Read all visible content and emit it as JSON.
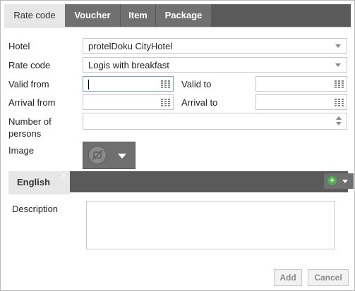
{
  "tabs": [
    {
      "label": "Rate code",
      "active": true
    },
    {
      "label": "Voucher",
      "active": false
    },
    {
      "label": "Item",
      "active": false
    },
    {
      "label": "Package",
      "active": false
    }
  ],
  "form": {
    "hotel_label": "Hotel",
    "hotel_value": "protelDoku CityHotel",
    "rate_code_label": "Rate code",
    "rate_code_value": "Logis with breakfast",
    "valid_from_label": "Valid from",
    "valid_from_value": "",
    "valid_to_label": "Valid to",
    "valid_to_value": "",
    "arrival_from_label": "Arrival from",
    "arrival_from_value": "",
    "arrival_to_label": "Arrival to",
    "arrival_to_value": "",
    "persons_label_line1": "Number of",
    "persons_label_line2": "persons",
    "persons_value": "",
    "image_label": "Image"
  },
  "language": {
    "tab_label": "English",
    "close_glyph": "×",
    "add_glyph": "+"
  },
  "description": {
    "label": "Description",
    "value": ""
  },
  "buttons": {
    "add_label": "Add",
    "cancel_label": "Cancel"
  },
  "colors": {
    "tabbar": "#5a5a5a",
    "tab_active": "#e7e7e7",
    "add_language_icon": "#4fb04f"
  },
  "icons": [
    "calendar-icon",
    "dropdown-caret-icon",
    "spinner-icon",
    "no-image-icon",
    "add-language-icon",
    "close-icon"
  ]
}
